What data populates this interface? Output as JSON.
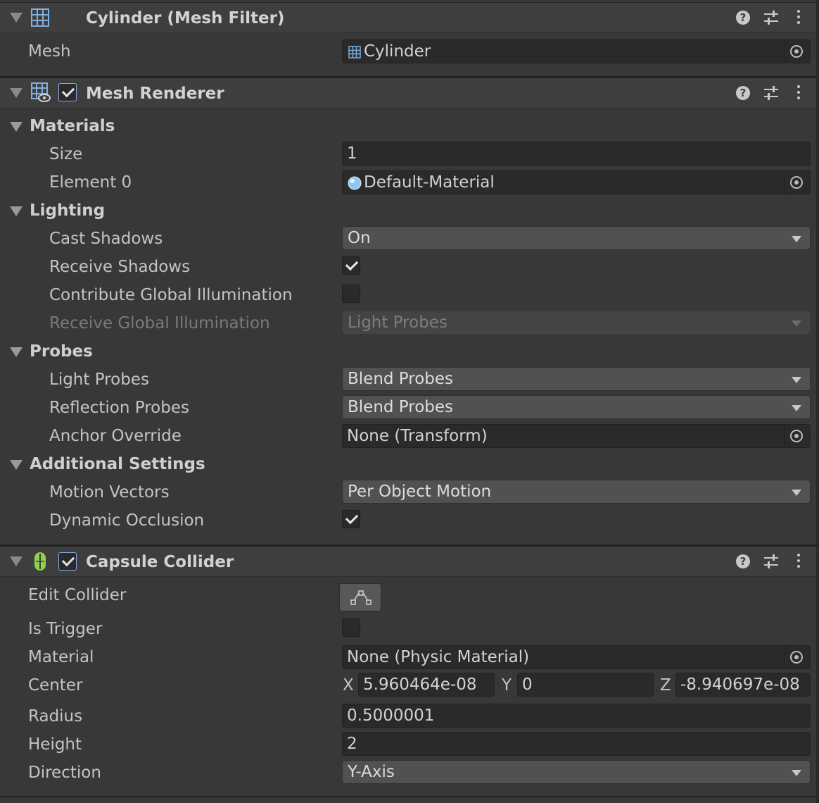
{
  "mesh_filter": {
    "title": "Cylinder (Mesh Filter)",
    "icon": "mesh-grid-icon",
    "mesh_label": "Mesh",
    "mesh_value": "Cylinder"
  },
  "mesh_renderer": {
    "title": "Mesh Renderer",
    "enabled": true,
    "materials": {
      "section": "Materials",
      "size_label": "Size",
      "size_value": "1",
      "element0_label": "Element 0",
      "element0_value": "Default-Material"
    },
    "lighting": {
      "section": "Lighting",
      "cast_shadows_label": "Cast Shadows",
      "cast_shadows_value": "On",
      "receive_shadows_label": "Receive Shadows",
      "receive_shadows": true,
      "contribute_gi_label": "Contribute Global Illumination",
      "contribute_gi": false,
      "receive_gi_label": "Receive Global Illumination",
      "receive_gi_value": "Light Probes"
    },
    "probes": {
      "section": "Probes",
      "light_probes_label": "Light Probes",
      "light_probes_value": "Blend Probes",
      "reflection_probes_label": "Reflection Probes",
      "reflection_probes_value": "Blend Probes",
      "anchor_override_label": "Anchor Override",
      "anchor_override_value": "None (Transform)"
    },
    "additional": {
      "section": "Additional Settings",
      "motion_vectors_label": "Motion Vectors",
      "motion_vectors_value": "Per Object Motion",
      "dynamic_occlusion_label": "Dynamic Occlusion",
      "dynamic_occlusion": true
    }
  },
  "capsule_collider": {
    "title": "Capsule Collider",
    "enabled": true,
    "edit_collider_label": "Edit Collider",
    "is_trigger_label": "Is Trigger",
    "is_trigger": false,
    "material_label": "Material",
    "material_value": "None (Physic Material)",
    "center_label": "Center",
    "center": {
      "x_label": "X",
      "x": "5.960464e-08",
      "y_label": "Y",
      "y": "0",
      "z_label": "Z",
      "z": "-8.940697e-08"
    },
    "radius_label": "Radius",
    "radius_value": "0.5000001",
    "height_label": "Height",
    "height_value": "2",
    "direction_label": "Direction",
    "direction_value": "Y-Axis"
  },
  "header_icons": [
    "help-icon",
    "presets-icon",
    "context-menu-icon"
  ],
  "colors": {
    "background": "#383838",
    "header": "#3e3e3e",
    "field": "#2a2a2a",
    "dropdown": "#515151",
    "collider_green": "#8fd14f",
    "checkbox_focus": "#8aa8e8",
    "material_blue": "#8ec8f0"
  }
}
